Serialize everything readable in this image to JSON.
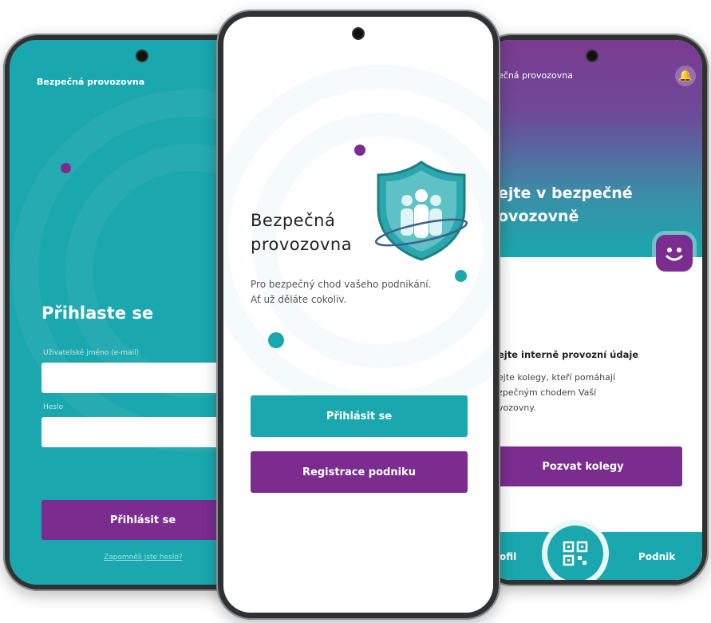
{
  "colors": {
    "teal": "#1aa7ad",
    "purple": "#7a2d8e",
    "white": "#ffffff"
  },
  "left_screen": {
    "brand": "Bezpečná provozovna",
    "title": "Přihlaste se",
    "username_label": "Uživatelské jméno (e-mail)",
    "password_label": "Heslo",
    "login_button": "Přihlásit se",
    "forgot_link": "Zapomněli jste heslo?"
  },
  "center_screen": {
    "title_line1": "Bezpečná",
    "title_line2": "provozovna",
    "subtitle": "Pro bezpečný chod vašeho podnikání. Ať už děláte cokoliv.",
    "login_button": "Přihlásit se",
    "register_button": "Registrace podniku",
    "logo_icon": "shield-people-icon"
  },
  "right_screen": {
    "brand": "ečná provozovna",
    "welcome_line1": "ejte v bezpečné",
    "welcome_line2": "ovozovně",
    "section_heading": "ejte interně provozní údaje",
    "section_text_1": "ejte kolegy, kteří pomáhají",
    "section_text_2": "zpečným chodem Vaší",
    "section_text_3": "vozovny.",
    "invite_button": "Pozvat kolegy",
    "nav_profile": "ofil",
    "nav_business": "Podnik",
    "bell_icon": "bell-icon",
    "qr_icon": "qr-code-icon"
  }
}
